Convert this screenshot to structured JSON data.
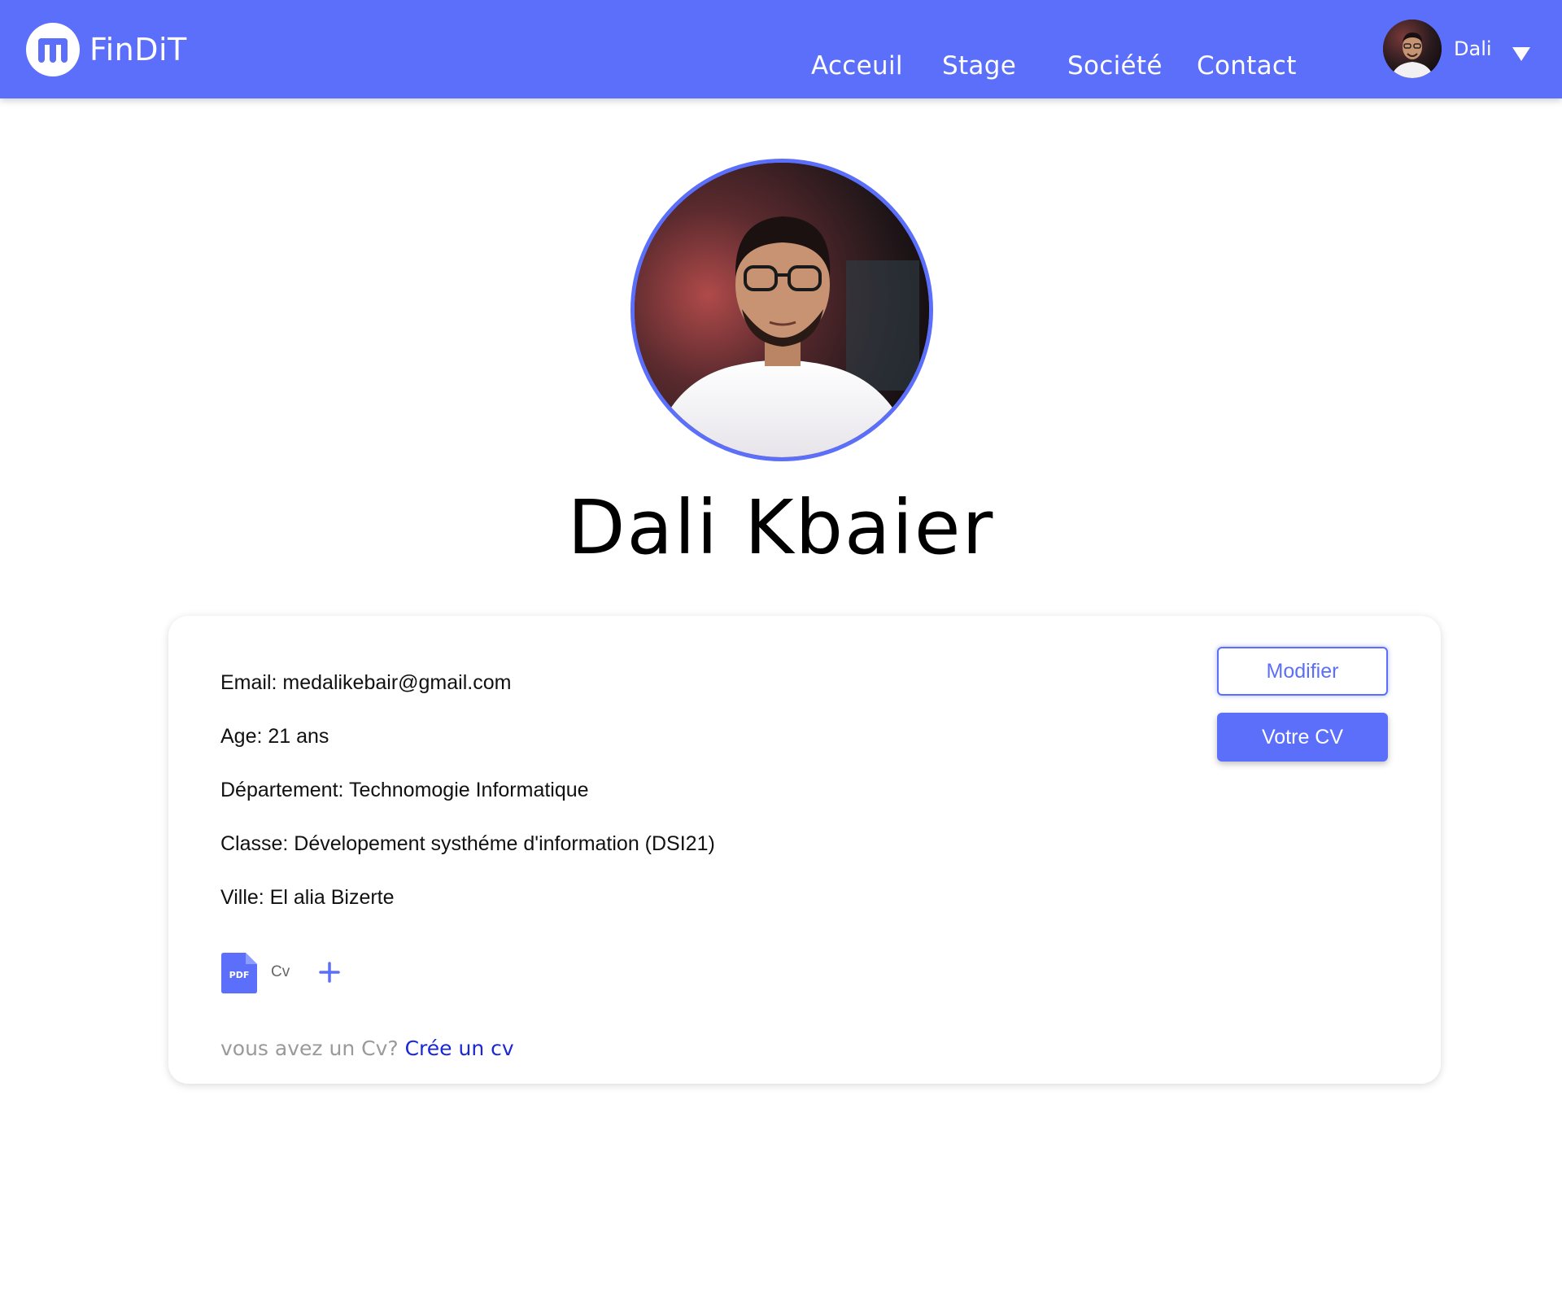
{
  "navbar": {
    "brand": "FinDiT",
    "links": [
      "Acceuil",
      "Stage",
      "Société",
      "Contact"
    ],
    "user_name": "Dali",
    "accent_color": "#5b6ffb"
  },
  "profile": {
    "full_name": "Dali Kbaier"
  },
  "info": {
    "email": "Email: medalikebair@gmail.com",
    "age": "Age: 21 ans",
    "departement": "Département: Technomogie Informatique",
    "classe": "Classe: Dévelopement systhéme d'information (DSI21)",
    "ville": "Ville: El alia Bizerte"
  },
  "actions": {
    "modifier_label": "Modifier",
    "cv_label": "Votre CV"
  },
  "files": {
    "pdf_badge": "PDF",
    "cv_file_name": "Cv"
  },
  "cv_prompt": {
    "question": "vous avez un Cv?",
    "link": "Crée un cv"
  },
  "icons": [
    "logo-icon",
    "avatar",
    "chevron-down-icon",
    "pdf-icon",
    "plus-icon"
  ]
}
